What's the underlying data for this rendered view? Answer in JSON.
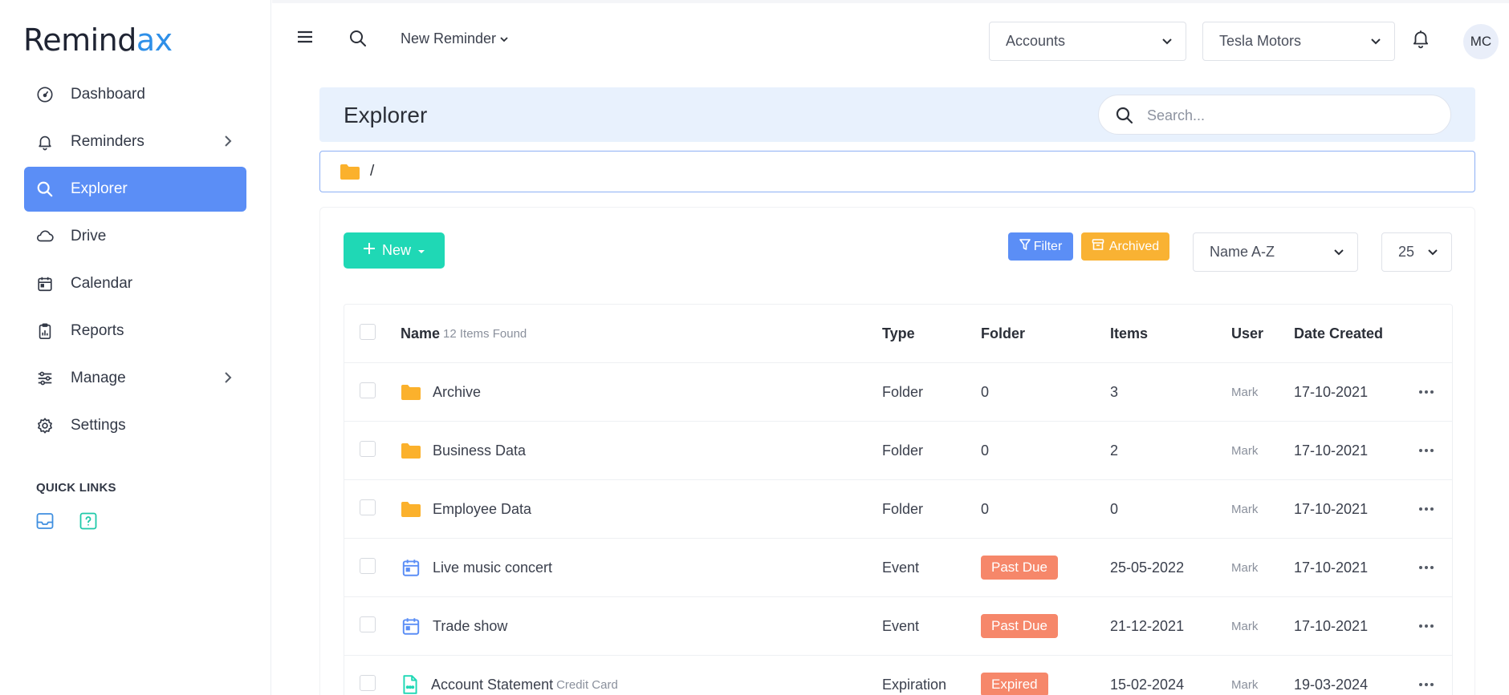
{
  "app": {
    "logo_main": "Remind",
    "logo_accent": "ax"
  },
  "sidebar": {
    "items": [
      {
        "label": "Dashboard"
      },
      {
        "label": "Reminders"
      },
      {
        "label": "Explorer"
      },
      {
        "label": "Drive"
      },
      {
        "label": "Calendar"
      },
      {
        "label": "Reports"
      },
      {
        "label": "Manage"
      },
      {
        "label": "Settings"
      }
    ],
    "quick_links_title": "QUICK LINKS"
  },
  "topbar": {
    "new_reminder": "New Reminder",
    "accounts_select": "Accounts",
    "company_select": "Tesla Motors",
    "avatar_initials": "MC"
  },
  "explorer": {
    "title": "Explorer",
    "search_placeholder": "Search...",
    "path": "/"
  },
  "toolbar": {
    "new_label": "New",
    "filter_label": "Filter",
    "archived_label": "Archived",
    "sort_value": "Name A-Z",
    "per_page_value": "25"
  },
  "colors": {
    "accent_blue": "#5b8ef6",
    "new_button": "#1fd8b5",
    "archived_button": "#f9b233",
    "badge_red": "#f6876a",
    "folder_yellow": "#fbb12c"
  },
  "table": {
    "headers": {
      "name": "Name",
      "count": "12 Items Found",
      "type": "Type",
      "folder": "Folder",
      "items": "Items",
      "user": "User",
      "date_created": "Date Created"
    },
    "rows": [
      {
        "icon": "folder-icon",
        "name": "Archive",
        "sub": "",
        "type": "Folder",
        "folder": "0",
        "items": "3",
        "user": "Mark",
        "date": "17-10-2021"
      },
      {
        "icon": "folder-icon",
        "name": "Business Data",
        "sub": "",
        "type": "Folder",
        "folder": "0",
        "items": "2",
        "user": "Mark",
        "date": "17-10-2021"
      },
      {
        "icon": "folder-icon",
        "name": "Employee Data",
        "sub": "",
        "type": "Folder",
        "folder": "0",
        "items": "0",
        "user": "Mark",
        "date": "17-10-2021"
      },
      {
        "icon": "calendar-icon",
        "name": "Live music concert",
        "sub": "",
        "type": "Event",
        "folder": "Past Due",
        "items": "25-05-2022",
        "user": "Mark",
        "date": "17-10-2021"
      },
      {
        "icon": "calendar-icon",
        "name": "Trade show",
        "sub": "",
        "type": "Event",
        "folder": "Past Due",
        "items": "21-12-2021",
        "user": "Mark",
        "date": "17-10-2021"
      },
      {
        "icon": "document-icon",
        "name": "Account Statement",
        "sub": "Credit Card",
        "type": "Expiration",
        "folder": "Expired",
        "items": "15-02-2024",
        "user": "Mark",
        "date": "19-03-2024"
      }
    ]
  }
}
